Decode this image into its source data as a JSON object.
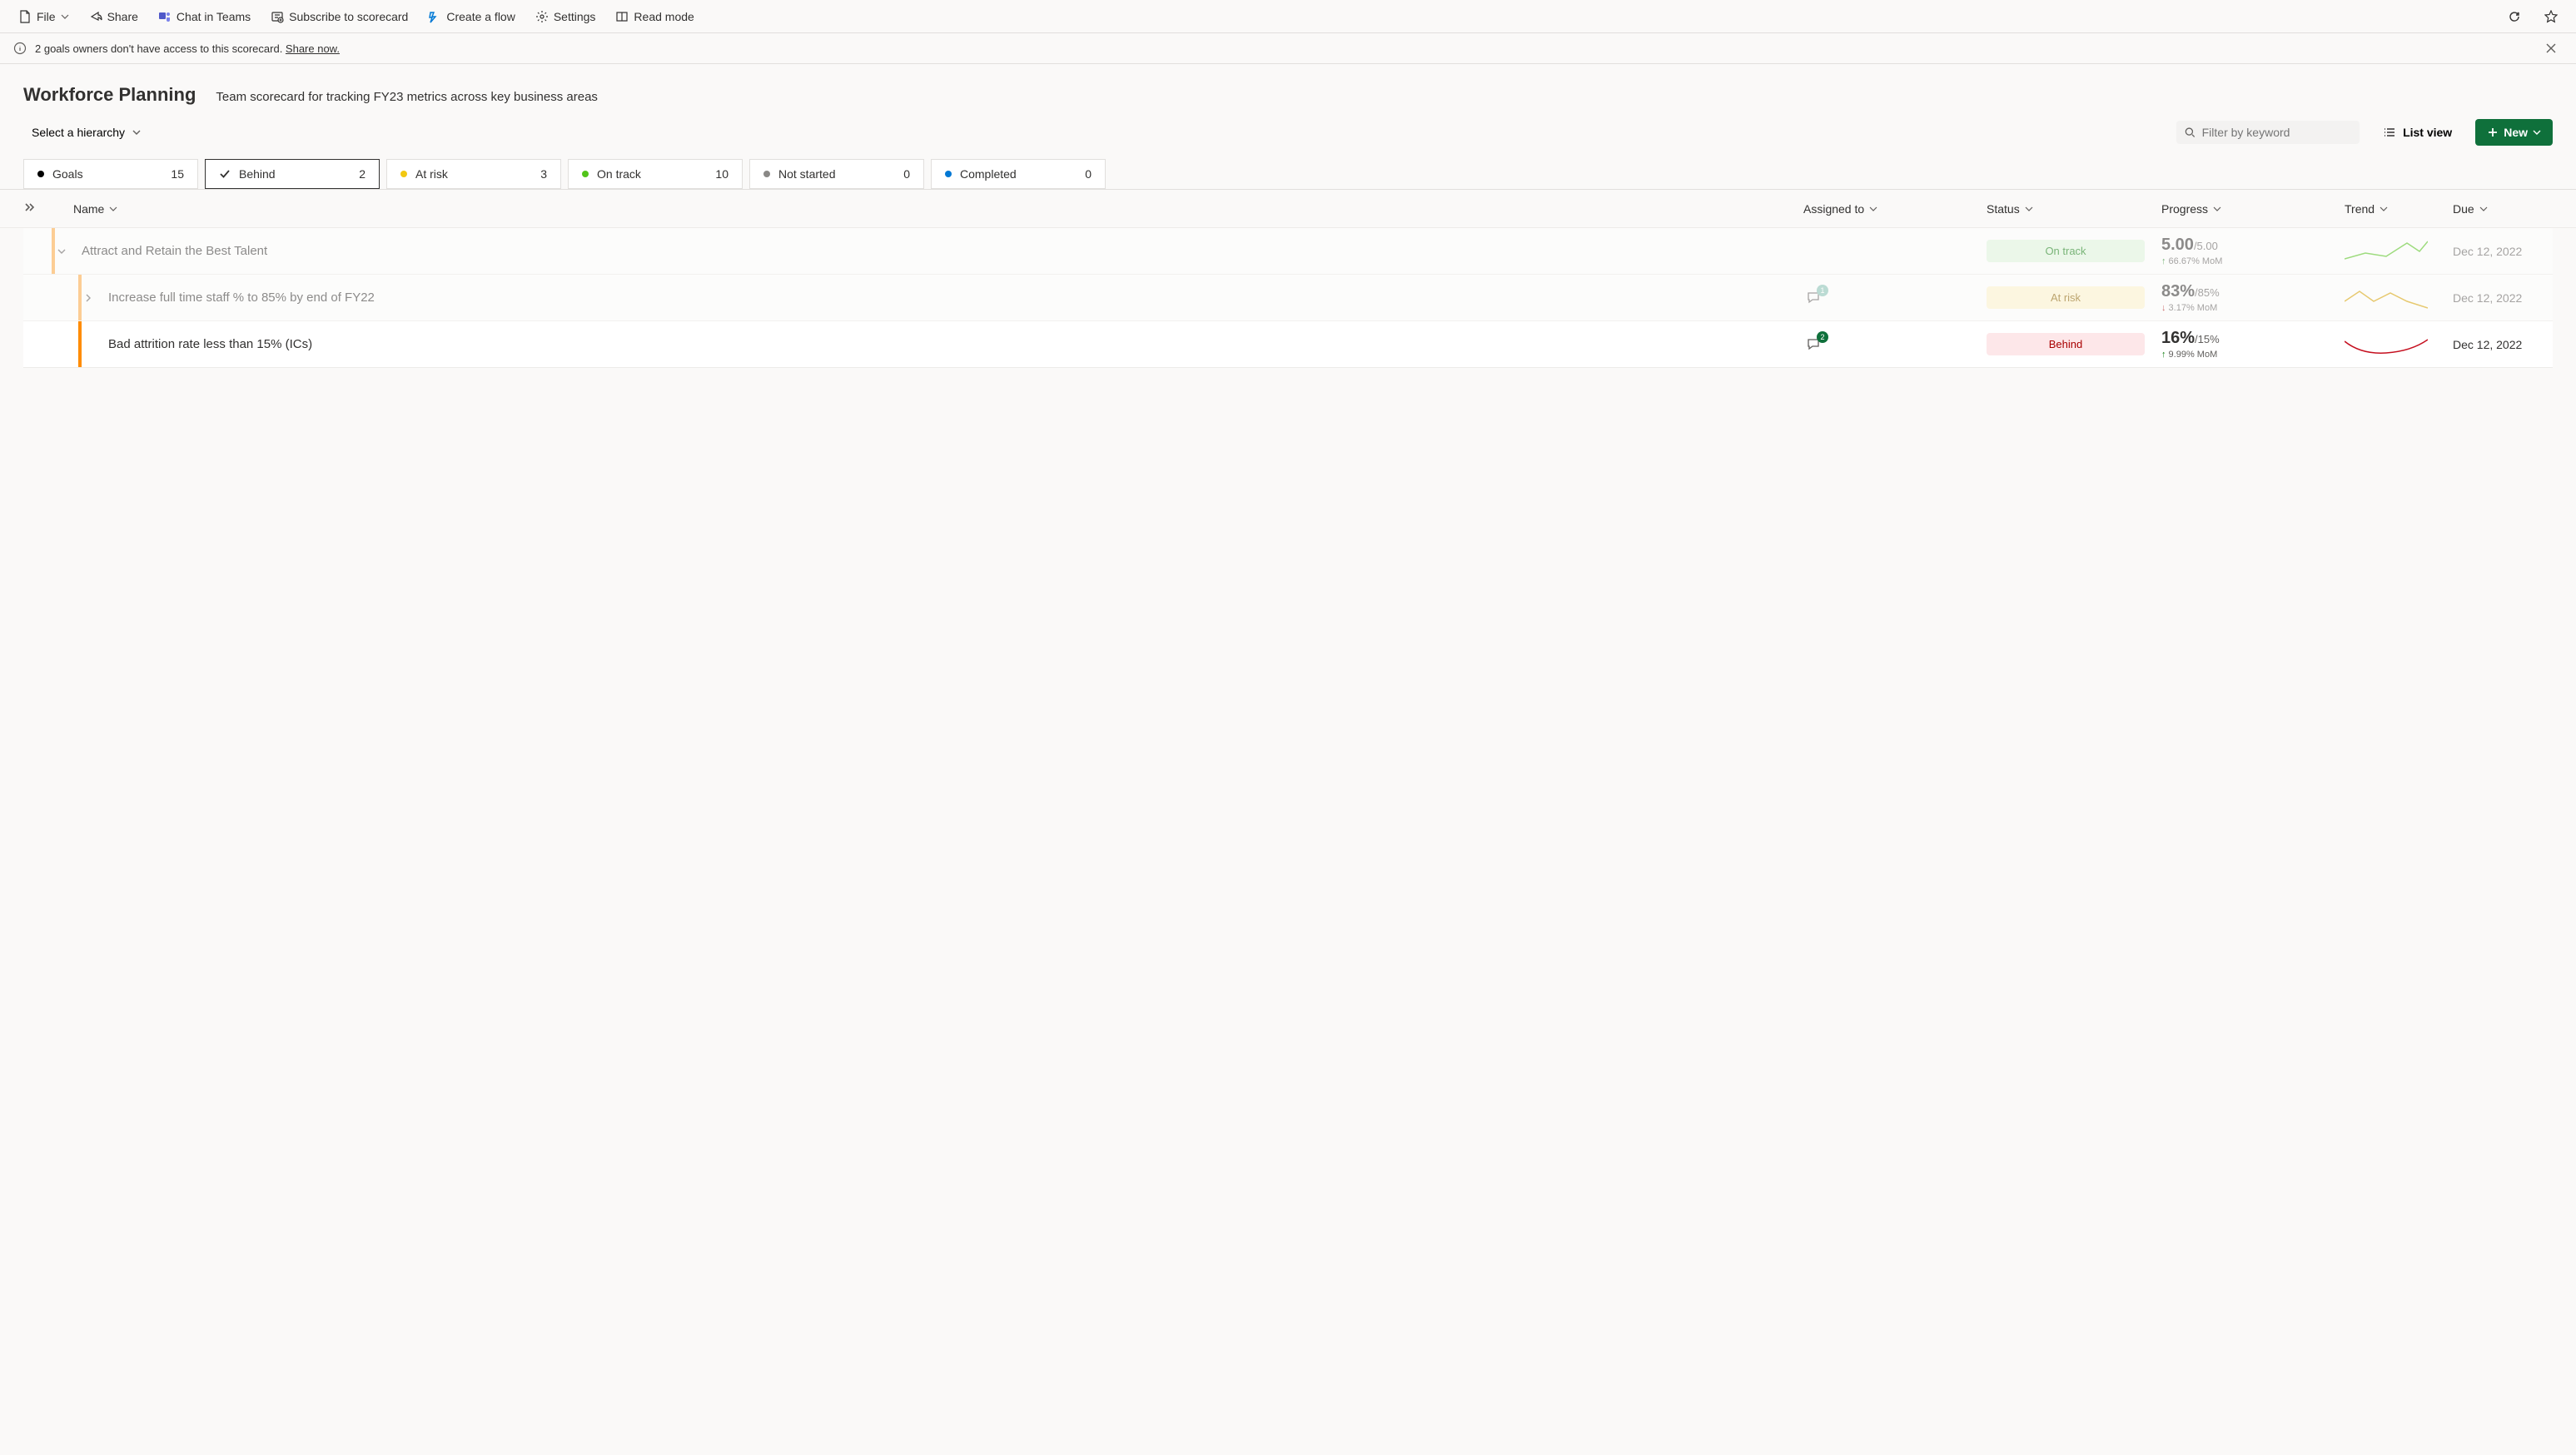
{
  "toolbar": {
    "file": "File",
    "share": "Share",
    "chat": "Chat in Teams",
    "subscribe": "Subscribe to scorecard",
    "flow": "Create a flow",
    "settings": "Settings",
    "readmode": "Read mode"
  },
  "message": {
    "text": "2 goals owners don't have access to this scorecard. ",
    "link": "Share now."
  },
  "header": {
    "title": "Workforce Planning",
    "subtitle": "Team scorecard for tracking FY23 metrics across key business areas",
    "hierarchy": "Select a hierarchy",
    "search_placeholder": "Filter by keyword",
    "list_view": "List view",
    "new_btn": "New"
  },
  "tabs": [
    {
      "label": "Goals",
      "count": "15",
      "mode": "dot",
      "color": "dot-black"
    },
    {
      "label": "Behind",
      "count": "2",
      "mode": "check",
      "selected": true
    },
    {
      "label": "At risk",
      "count": "3",
      "mode": "dot",
      "color": "dot-yellow"
    },
    {
      "label": "On track",
      "count": "10",
      "mode": "dot",
      "color": "dot-green"
    },
    {
      "label": "Not started",
      "count": "0",
      "mode": "dot",
      "color": "dot-grey"
    },
    {
      "label": "Completed",
      "count": "0",
      "mode": "dot",
      "color": "dot-blue"
    }
  ],
  "columns": {
    "name": "Name",
    "assigned": "Assigned to",
    "status": "Status",
    "progress": "Progress",
    "trend": "Trend",
    "due": "Due"
  },
  "rows": [
    {
      "level": 0,
      "faded": true,
      "stripe": "orange",
      "name": "Attract and Retain the Best Talent",
      "chev": "down",
      "comment_count": null,
      "badge_color": null,
      "status_label": "On track",
      "status_class": "pill-ontrack",
      "progress_main": "5.00",
      "progress_denom": "/5.00",
      "progress_dir": "up",
      "progress_sub": "66.67% MoM",
      "trend": "green_up",
      "due": "Dec 12, 2022"
    },
    {
      "level": 1,
      "faded": true,
      "stripe": "orange",
      "name": "Increase full time staff % to 85% by end of FY22",
      "chev": "right",
      "comment_count": "1",
      "badge_color": "#88c3b5",
      "status_label": "At risk",
      "status_class": "pill-atrisk",
      "progress_main": "83%",
      "progress_denom": "/85%",
      "progress_dir": "down",
      "progress_sub": "3.17% MoM",
      "trend": "yellow_zig",
      "due": "Dec 12, 2022"
    },
    {
      "level": 1,
      "faded": false,
      "stripe": "orange-dark",
      "name": "Bad attrition rate less than 15% (ICs)",
      "chev": null,
      "comment_count": "2",
      "badge_color": "#0f703b",
      "status_label": "Behind",
      "status_class": "pill-behind",
      "progress_main": "16%",
      "progress_denom": "/15%",
      "progress_dir": "up",
      "progress_sub": "9.99% MoM",
      "trend": "red_dip",
      "due": "Dec 12, 2022"
    }
  ]
}
